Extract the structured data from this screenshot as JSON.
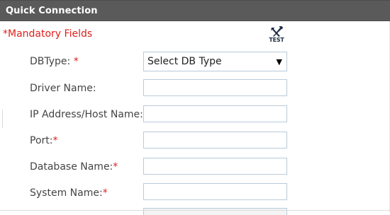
{
  "header": {
    "title": "Quick Connection"
  },
  "form": {
    "mandatory_note": "*Mandatory Fields",
    "test_label": "TEST",
    "required_marker": "*",
    "fields": [
      {
        "label": "DBType: ",
        "required": true,
        "type": "select",
        "value": "Select DB Type"
      },
      {
        "label": "Driver Name:",
        "required": false,
        "type": "text",
        "value": ""
      },
      {
        "label": "IP Address/Host Name:",
        "required": true,
        "type": "text",
        "value": ""
      },
      {
        "label": "Port:",
        "required": true,
        "type": "text",
        "value": ""
      },
      {
        "label": "Database Name:",
        "required": true,
        "type": "text",
        "value": ""
      },
      {
        "label": "System Name:",
        "required": true,
        "type": "text",
        "value": ""
      }
    ],
    "select_arrow": "▼"
  },
  "colors": {
    "header_bg": "#5a5a5a",
    "required_red": "#e0201b",
    "input_border": "#b8cbdb",
    "label_text": "#444444"
  },
  "icons": {
    "test": "tools-test-icon"
  }
}
